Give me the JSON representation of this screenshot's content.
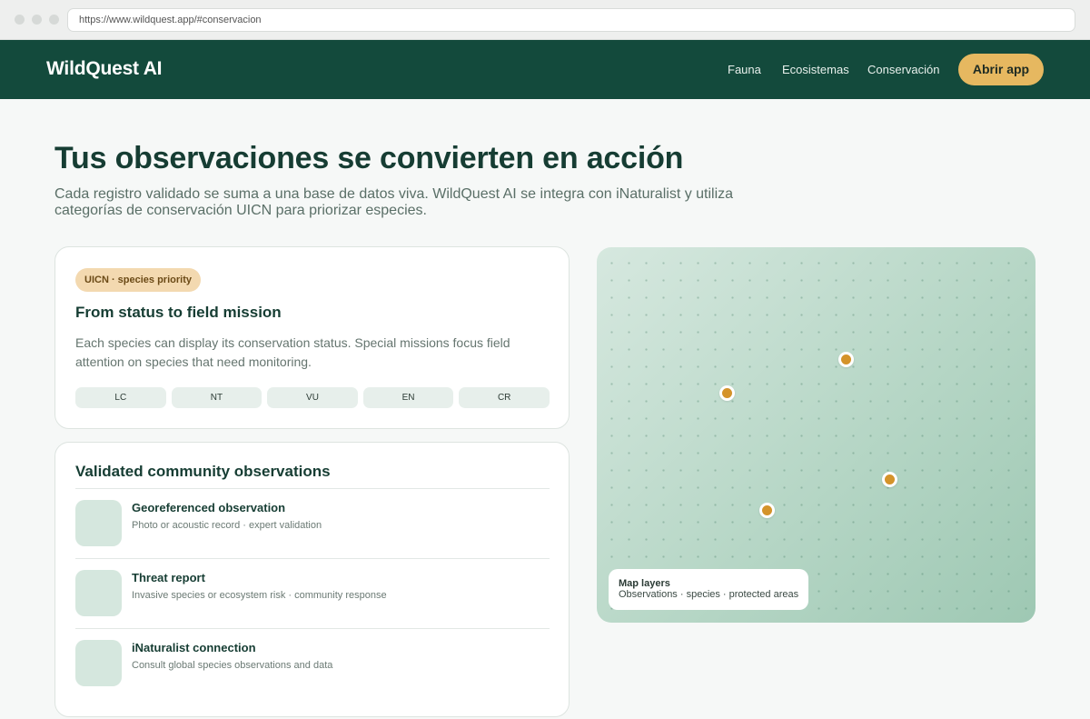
{
  "browser": {
    "url": "https://www.wildquest.app/#conservacion"
  },
  "nav": {
    "brand": "WildQuest AI",
    "links": [
      "Fauna",
      "Ecosistemas",
      "Conservación"
    ],
    "cta_label": "Abrir app",
    "background": "#134a3c",
    "cta_color": "#e6b860"
  },
  "hero": {
    "title": "Tus observaciones se convierten en acción",
    "subtitle": "Cada registro validado se suma a una base de datos viva. WildQuest AI se integra con iNaturalist y utiliza categorías de conservación UICN para priorizar especies."
  },
  "status_card": {
    "badge": "UICN · species priority",
    "title": "From status to field mission",
    "body": "Each species can display its conservation status. Special missions focus field attention on species that need monitoring.",
    "statuses": [
      "LC",
      "NT",
      "VU",
      "EN",
      "CR"
    ]
  },
  "observations_card": {
    "title": "Validated community observations",
    "items": [
      {
        "title": "Georeferenced observation",
        "description": "Photo or acoustic record · expert validation",
        "icon": "observation-thumbnail"
      },
      {
        "title": "Threat report",
        "description": "Invasive species or ecosystem risk · community response",
        "icon": "threat-thumbnail"
      },
      {
        "title": "iNaturalist connection",
        "description": "Consult global species observations and data",
        "icon": "inaturalist-thumbnail"
      }
    ]
  },
  "map": {
    "legend_title": "Map layers",
    "legend_text": "Observations · species · protected areas",
    "pin_color": "#d4932a",
    "pins": 4
  }
}
